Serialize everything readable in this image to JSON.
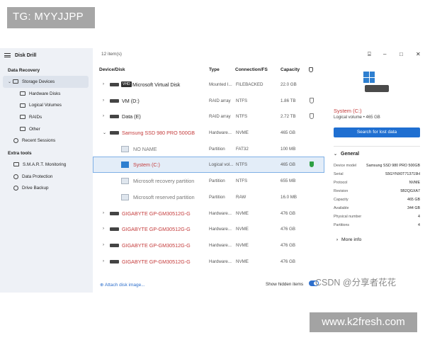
{
  "watermarks": {
    "tg": "TG: MYYJJPP",
    "csdn": "CSDN @分享者花花",
    "site": "www.k2fresh.com"
  },
  "sidebar": {
    "app_title": "Disk Drill",
    "sections": [
      {
        "title": "Data Recovery"
      },
      {
        "title": "Extra tools"
      }
    ],
    "recovery_items": [
      {
        "label": "Storage Devices",
        "icon": "storage-icon",
        "active": true
      },
      {
        "label": "Hardware Disks",
        "icon": "disk-icon"
      },
      {
        "label": "Logical Volumes",
        "icon": "volume-icon"
      },
      {
        "label": "RAIDs",
        "icon": "raid-icon"
      },
      {
        "label": "Other",
        "icon": "other-icon"
      },
      {
        "label": "Recent Sessions",
        "icon": "gear-icon"
      }
    ],
    "tool_items": [
      {
        "label": "S.M.A.R.T. Monitoring",
        "icon": "monitor-icon"
      },
      {
        "label": "Data Protection",
        "icon": "shield-icon"
      },
      {
        "label": "Drive Backup",
        "icon": "backup-icon"
      }
    ]
  },
  "main": {
    "items_count": "12 item(s)",
    "columns": {
      "device": "Device/Disk",
      "type": "Type",
      "connection": "Connection/FS",
      "capacity": "Capacity"
    },
    "rows": [
      {
        "name": "Microsoft Virtual Disk",
        "type": "Mounted I...",
        "conn": "FILEBACKED",
        "cap": "22.0 GB",
        "badge": "VHD"
      },
      {
        "name": "VM (D:)",
        "type": "RAID array",
        "conn": "NTFS",
        "cap": "1.86 TB"
      },
      {
        "name": "Data (E)",
        "type": "RAID array",
        "conn": "NTFS",
        "cap": "2.72 TB"
      },
      {
        "name": "Samsung SSD 980 PRO 500GB",
        "type": "Hardware...",
        "conn": "NVME",
        "cap": "465 GB"
      },
      {
        "name": "NO NAME",
        "type": "Partition",
        "conn": "FAT32",
        "cap": "100 MB"
      },
      {
        "name": "System (C:)",
        "type": "Logical vol...",
        "conn": "NTFS",
        "cap": "465 GB"
      },
      {
        "name": "Microsoft recovery partition",
        "type": "Partition",
        "conn": "NTFS",
        "cap": "655 MB"
      },
      {
        "name": "Microsoft reserved partition",
        "type": "Partition",
        "conn": "RAW",
        "cap": "16.0 MB"
      },
      {
        "name": "GIGABYTE GP-GM30512G-G",
        "type": "Hardware...",
        "conn": "NVME",
        "cap": "476 GB"
      },
      {
        "name": "GIGABYTE GP-GM30512G-G",
        "type": "Hardware...",
        "conn": "NVME",
        "cap": "476 GB"
      },
      {
        "name": "GIGABYTE GP-GM30512G-G",
        "type": "Hardware...",
        "conn": "NVME",
        "cap": "476 GB"
      },
      {
        "name": "GIGABYTE GP-GM30512G-G",
        "type": "Hardware...",
        "conn": "NVME",
        "cap": "476 GB"
      }
    ],
    "attach_label": "Attach disk image...",
    "show_hidden_label": "Show hidden items"
  },
  "details": {
    "title": "System (C:)",
    "subtitle": "Logical volume • 465 GB",
    "search_button": "Search for lost data",
    "general_label": "General",
    "fields": [
      {
        "k": "Device model",
        "v": "Samsung SSD 980 PRO 500GB"
      },
      {
        "k": "Serial",
        "v": "S5GYNX0T713719H"
      },
      {
        "k": "Protocol",
        "v": "NVME"
      },
      {
        "k": "Revision",
        "v": "5B2QGXA7"
      },
      {
        "k": "Capacity",
        "v": "465 GB"
      },
      {
        "k": "Available",
        "v": "344 GB"
      },
      {
        "k": "Physical number",
        "v": "4"
      },
      {
        "k": "Partitions",
        "v": "4"
      }
    ],
    "more_info": "More info"
  },
  "colors": {
    "accent": "#1f6fd1",
    "danger": "#c43b3b",
    "ok": "#2ea043"
  }
}
